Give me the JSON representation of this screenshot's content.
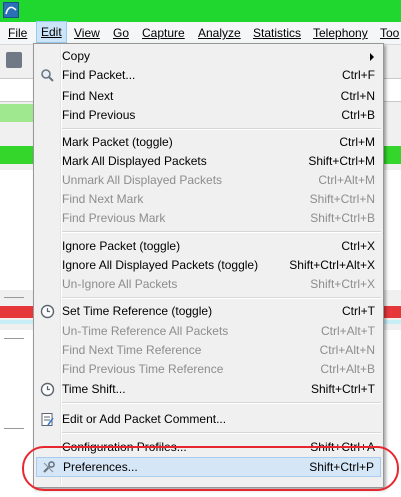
{
  "menubar": {
    "items": [
      "File",
      "Edit",
      "View",
      "Go",
      "Capture",
      "Analyze",
      "Statistics",
      "Telephony",
      "Too"
    ]
  },
  "edit_menu": {
    "items": [
      {
        "label": "Copy",
        "shortcut": "",
        "enabled": true,
        "submenu": true
      },
      {
        "label": "Find Packet...",
        "shortcut": "Ctrl+F",
        "enabled": true,
        "icon": "search-icon"
      },
      {
        "label": "Find Next",
        "shortcut": "Ctrl+N",
        "enabled": true
      },
      {
        "label": "Find Previous",
        "shortcut": "Ctrl+B",
        "enabled": true
      },
      {
        "label": "Mark Packet (toggle)",
        "shortcut": "Ctrl+M",
        "enabled": true
      },
      {
        "label": "Mark All Displayed Packets",
        "shortcut": "Shift+Ctrl+M",
        "enabled": true
      },
      {
        "label": "Unmark All Displayed Packets",
        "shortcut": "Ctrl+Alt+M",
        "enabled": false
      },
      {
        "label": "Find Next Mark",
        "shortcut": "Shift+Ctrl+N",
        "enabled": false
      },
      {
        "label": "Find Previous Mark",
        "shortcut": "Shift+Ctrl+B",
        "enabled": false
      },
      {
        "label": "Ignore Packet (toggle)",
        "shortcut": "Ctrl+X",
        "enabled": true
      },
      {
        "label": "Ignore All Displayed Packets (toggle)",
        "shortcut": "Shift+Ctrl+Alt+X",
        "enabled": true
      },
      {
        "label": "Un-Ignore All Packets",
        "shortcut": "Shift+Ctrl+X",
        "enabled": false
      },
      {
        "label": "Set Time Reference (toggle)",
        "shortcut": "Ctrl+T",
        "enabled": true,
        "icon": "clock-icon"
      },
      {
        "label": "Un-Time Reference All Packets",
        "shortcut": "Ctrl+Alt+T",
        "enabled": false
      },
      {
        "label": "Find Next Time Reference",
        "shortcut": "Ctrl+Alt+N",
        "enabled": false
      },
      {
        "label": "Find Previous Time Reference",
        "shortcut": "Ctrl+Alt+B",
        "enabled": false
      },
      {
        "label": "Time Shift...",
        "shortcut": "Shift+Ctrl+T",
        "enabled": true,
        "icon": "clock-icon"
      },
      {
        "label": "Edit or Add Packet Comment...",
        "shortcut": "",
        "enabled": true,
        "icon": "comment-icon"
      },
      {
        "label": "Configuration Profiles...",
        "shortcut": "Shift+Ctrl+A",
        "enabled": true
      },
      {
        "label": "Preferences...",
        "shortcut": "Shift+Ctrl+P",
        "enabled": true,
        "icon": "wrench-icon",
        "selected": true
      }
    ]
  },
  "colors": {
    "titlebar": "#1fd72f",
    "selection": "#d5e6f7",
    "highlight_ring": "#e8262e"
  }
}
